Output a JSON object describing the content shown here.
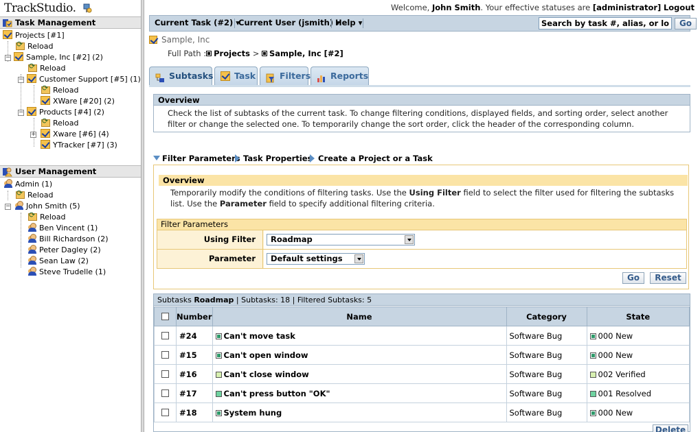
{
  "app": {
    "logo": "TrackStudio."
  },
  "left": {
    "task_management": {
      "title": "Task Management",
      "items": [
        {
          "label": "Projects [#1]"
        },
        {
          "label": "Reload"
        },
        {
          "label": "Sample, Inc [#2] (2)"
        },
        {
          "label": "Reload"
        },
        {
          "label": "Customer Support [#5] (1)"
        },
        {
          "label": "Reload"
        },
        {
          "label": "XWare [#20] (2)"
        },
        {
          "label": "Products [#4] (2)"
        },
        {
          "label": "Reload"
        },
        {
          "label": "Xware [#6] (4)"
        },
        {
          "label": "YTracker [#7] (3)"
        }
      ]
    },
    "user_management": {
      "title": "User Management",
      "items": [
        {
          "label": "Admin (1)"
        },
        {
          "label": "Reload"
        },
        {
          "label": "John Smith (5)"
        },
        {
          "label": "Reload"
        },
        {
          "label": "Ben Vincent (1)"
        },
        {
          "label": "Bill Richardson (2)"
        },
        {
          "label": "Peter Dagley (2)"
        },
        {
          "label": "Sean Law (2)"
        },
        {
          "label": "Steve Trudelle (1)"
        }
      ]
    }
  },
  "header": {
    "welcome_prefix": "Welcome,",
    "user_name": "John Smith",
    "statuses_text": ". Your effective statuses are",
    "statuses": "[administrator]",
    "logout": "Logout"
  },
  "menu": {
    "current_task": "Current Task (#2)",
    "current_user": "Current User (jsmith)",
    "help": "Help",
    "search_value": "Search by task #, alias, or login",
    "go": "Go"
  },
  "task": {
    "title": "Sample, Inc",
    "full_path_label": "Full Path :",
    "path_1": "Projects",
    "path_sep": ">",
    "path_2": "Sample, Inc [#2]"
  },
  "tabs": [
    {
      "label": "Subtasks"
    },
    {
      "label": "Task"
    },
    {
      "label": "Filters"
    },
    {
      "label": "Reports"
    }
  ],
  "overview": {
    "title": "Overview",
    "text": "Check the list of subtasks of the current task. To change filtering conditions, displayed fields, and sorting order, select another filter or change the selected one. To temporarily change the sort order, click the header of the corresponding column."
  },
  "subnav": {
    "filter_parameters": "Filter Parameters",
    "task_properties": "Task Properties",
    "create": "Create a Project or a Task"
  },
  "filter_box": {
    "overview_title": "Overview",
    "overview_text_1": "Temporarily modify the conditions of filtering tasks. Use the",
    "overview_bold_1": "Using Filter",
    "overview_text_2": "field to select the filter used for filtering the subtasks list. Use the",
    "overview_bold_2": "Parameter",
    "overview_text_3": "field to specify additional filtering criteria.",
    "params_title": "Filter Parameters",
    "using_filter_label": "Using Filter",
    "using_filter_value": "Roadmap",
    "parameter_label": "Parameter",
    "parameter_value": "Default settings",
    "go": "Go",
    "reset": "Reset"
  },
  "subtasks": {
    "prefix": "Subtasks",
    "filter_name": "Roadmap",
    "count_text": "| Subtasks: 18 | Filtered Subtasks: 5",
    "columns": {
      "number": "Number",
      "name": "Name",
      "category": "Category",
      "state": "State"
    },
    "rows": [
      {
        "number": "#24",
        "name": "Can't move task",
        "category": "Software Bug",
        "state": "000 New",
        "state_kind": "new"
      },
      {
        "number": "#15",
        "name": "Can't open window",
        "category": "Software Bug",
        "state": "000 New",
        "state_kind": "new"
      },
      {
        "number": "#16",
        "name": "Can't close window",
        "category": "Software Bug",
        "state": "002 Verified",
        "state_kind": "verified"
      },
      {
        "number": "#17",
        "name": "Can't press button \"OK\"",
        "category": "Software Bug",
        "state": "001 Resolved",
        "state_kind": "resolved"
      },
      {
        "number": "#18",
        "name": "System hung",
        "category": "Software Bug",
        "state": "000 New",
        "state_kind": "new"
      }
    ],
    "delete": "Delete"
  }
}
